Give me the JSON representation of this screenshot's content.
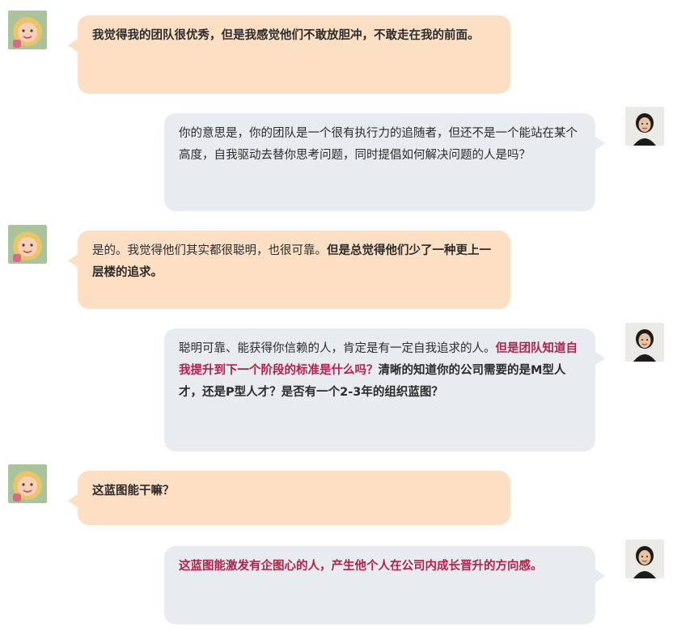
{
  "messages": [
    {
      "side": "left",
      "segments": [
        {
          "text": "我觉得我的团队很优秀，但是我感觉他们不敢放胆冲，不敢走在我的前面。",
          "style": "bold"
        }
      ]
    },
    {
      "side": "right",
      "segments": [
        {
          "text": "你的意思是，你的团队是一个很有执行力的追随者，但还不是一个能站在某个高度，自我驱动去替你思考问题，同时提倡如何解决问题的人是吗？",
          "style": "normal"
        }
      ]
    },
    {
      "side": "left",
      "segments": [
        {
          "text": "是的。我觉得他们其实都很聪明，也很可靠。",
          "style": "normal"
        },
        {
          "text": "但是总觉得他们少了一种更上一层楼的追求。",
          "style": "bold"
        }
      ]
    },
    {
      "side": "right",
      "segments": [
        {
          "text": "聪明可靠、能获得你信赖的人，肯定是有一定自我追求的人。",
          "style": "normal"
        },
        {
          "text": "但是团队知道自我提升到下一个阶段的标准是什么吗？",
          "style": "highlight"
        },
        {
          "text": "清晰的知道你的公司需要的是M型人才，还是P型人才？是否有一个2-3年的组织蓝图？",
          "style": "bold"
        }
      ]
    },
    {
      "side": "left",
      "segments": [
        {
          "text": "这蓝图能干嘛？",
          "style": "bold"
        }
      ]
    },
    {
      "side": "right",
      "segments": [
        {
          "text": "这蓝图能激发有企图心的人，产生他个人在公司内成长晋升的方向感。",
          "style": "highlight"
        }
      ]
    }
  ],
  "avatars": {
    "client": "child-avatar",
    "coach": "woman-avatar"
  },
  "colors": {
    "left_bubble": "#fde0c4",
    "right_bubble": "#e8ebef",
    "highlight_text": "#b3204b"
  }
}
